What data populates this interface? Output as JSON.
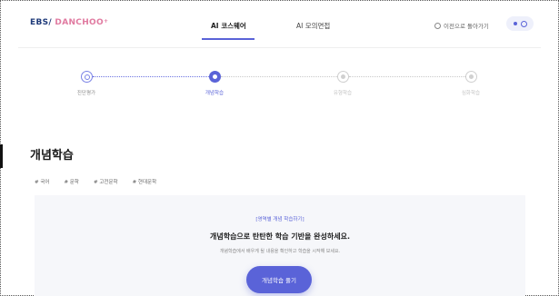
{
  "logo": {
    "ebs": "EBS",
    "slash": "/",
    "danchoo": "DANCHOO",
    "plus": "+"
  },
  "nav": {
    "tabs": [
      {
        "label": "AI 코스웨어",
        "active": true
      },
      {
        "label": "AI 모의면접",
        "active": false
      }
    ],
    "back_link": "이전으로 돌아가기",
    "accent_color": "#5a63d8"
  },
  "stepper": {
    "steps": [
      {
        "label": "진단평가",
        "state": "done"
      },
      {
        "label": "개념학습",
        "state": "active"
      },
      {
        "label": "유형학습",
        "state": "todo"
      },
      {
        "label": "심화학습",
        "state": "todo"
      }
    ]
  },
  "page": {
    "title": "개념학습",
    "filters": [
      "# 국어",
      "# 문학",
      "# 고전문학",
      "# 현대문학"
    ]
  },
  "card": {
    "tag": "[영역별 개념 학습하기]",
    "headline": "개념학습으로 탄탄한 학습 기반을 완성하세요.",
    "description": "개념학습에서 배우게 될 내용을 확인하고 학습을 시작해 보세요.",
    "button_label": "개념학습 풀기"
  }
}
